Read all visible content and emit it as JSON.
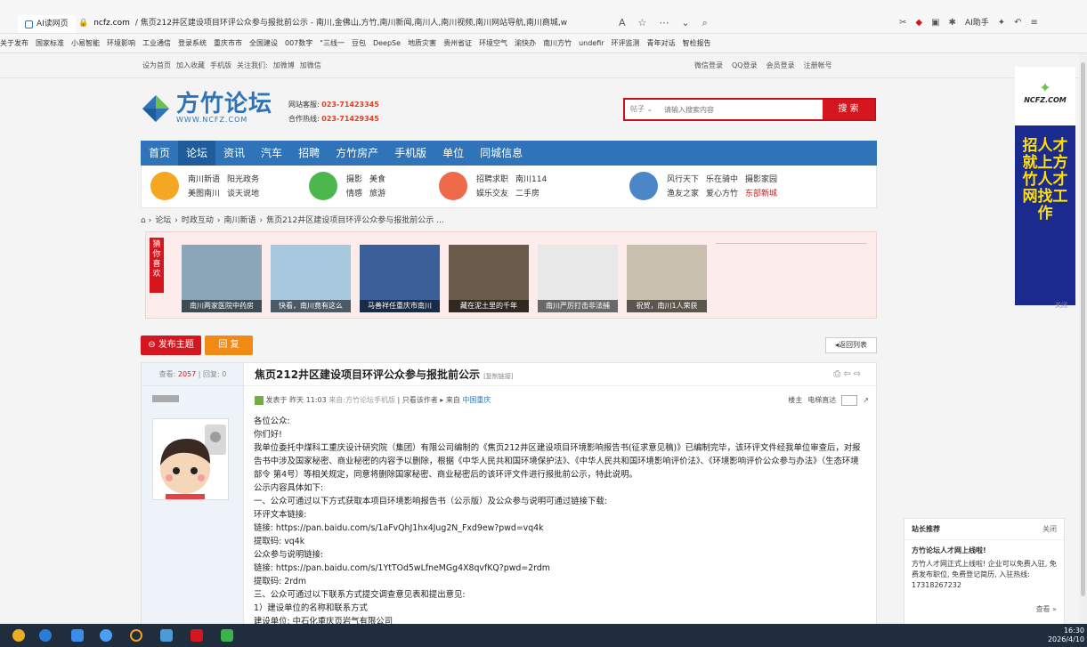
{
  "browser": {
    "tab_label": "AI读网页",
    "url_host": "ncfz.com",
    "url_rest": "/ 焦页212井区建设项目环评公众参与报批前公示 - 南川,金佛山,方竹,南川新闻,南川人,南川视频,南川网站导航,南川商城,w",
    "ai_label": "AI助手"
  },
  "bookmarks": [
    "关于发布",
    "国家标准",
    "小易智能",
    "环境影响",
    "工业通信",
    "登录系统",
    "重庆市市",
    "全国建设",
    "007数字",
    "\"三线一",
    "豆包",
    "DeepSe",
    "地质灾害",
    "贵州省证",
    "环境空气",
    "渝快办",
    "南川方竹",
    "undefir",
    "环评监测",
    "青年对话",
    "智检报告"
  ],
  "topbar": {
    "links": [
      "设为首页",
      "加入收藏",
      "手机版",
      "关注我们:",
      "加微博",
      "加微信"
    ],
    "right_links": [
      "微信登录",
      "QQ登录",
      "会员登录",
      "注册帐号"
    ]
  },
  "header": {
    "logo_text": "方竹论坛",
    "logo_sub": "WWW.NCFZ.COM",
    "hotline1_label": "网站客服:",
    "hotline1": "023-71423345",
    "hotline2_label": "合作热线:",
    "hotline2": "023-71429345"
  },
  "search": {
    "type": "帖子",
    "placeholder": "请输入搜索内容",
    "button": "搜 索"
  },
  "nav": [
    "首页",
    "论坛",
    "资讯",
    "汽车",
    "招聘",
    "方竹房产",
    "手机版",
    "单位",
    "同城信息"
  ],
  "subnav": [
    {
      "row1": [
        "南川新语",
        "阳光政务"
      ],
      "row2": [
        "美图南川",
        "谈天说地"
      ],
      "color": "#f5a623"
    },
    {
      "row1": [
        "摄影",
        "美食"
      ],
      "row2": [
        "情感",
        "旅游"
      ],
      "color": "#4cb74c"
    },
    {
      "row1": [
        "招聘求职",
        "南川114"
      ],
      "row2": [
        "娱乐交友",
        "二手房"
      ],
      "color": "#ee6a4a"
    },
    {
      "row1": [
        "风行天下",
        "乐在骑中",
        "摄影家园"
      ],
      "row2": [
        "渔友之家",
        "爱心方竹",
        "东部新城"
      ],
      "color": "#4a86c8"
    }
  ],
  "breadcrumb": [
    "论坛",
    "时政互动",
    "南川新语",
    "焦页212井区建设项目环评公众参与报批前公示 ..."
  ],
  "showcase": {
    "tag": "猜你喜欢",
    "items": [
      {
        "caption": "南川两家医院中药房",
        "color": "#8aa6b8"
      },
      {
        "caption": "快看，南川竟有这么",
        "color": "#a8c8e0"
      },
      {
        "caption": "马善祥任重庆市南川",
        "color": "#3a5f99"
      },
      {
        "caption": "藏在泥土里的千年",
        "color": "#6a5a4a"
      },
      {
        "caption": "南川严厉打击非法捕",
        "color": "#e8e8e8"
      },
      {
        "caption": "祝贺，南川1人荣获",
        "color": "#c8bfae"
      }
    ]
  },
  "actions": {
    "post": "发布主题",
    "reply": "回 复",
    "back": "返回列表"
  },
  "thread": {
    "views_label": "查看:",
    "views": "2057",
    "replies_label": "回复:",
    "replies": "0",
    "title": "焦页212井区建设项目环评公众参与报批前公示",
    "copy_link": "[复制链接]",
    "meta_prefix": "发表于",
    "meta_time": "昨天 11:03",
    "meta_source": "来自:方竹论坛手机版",
    "meta_only": "只看该作者",
    "meta_from": "来自",
    "meta_loc": "中国重庆",
    "floor": "楼主",
    "jump": "电梯直达",
    "content": [
      "各位公众:",
      "你们好!",
      "我单位委托中煤科工重庆设计研究院（集团）有限公司编制的《焦页212井区建设项目环境影响报告书(征求意见稿)》已编制完毕，该环评文件经我单位审查后，对报告书中涉及国家秘密、商业秘密的内容予以删除，根据《中华人民共和国环境保护法》、《中华人民共和国环境影响评价法》、《环境影响评价公众参与办法》（生态环境部令 第4号）等相关规定，同意将删除国家秘密、商业秘密后的该环评文件进行报批前公示，特此说明。",
      "公示内容具体如下:",
      "一、公众可通过以下方式获取本项目环境影响报告书（公示版）及公众参与说明可通过链接下载:",
      "环评文本链接:",
      "链接: https://pan.baidu.com/s/1aFvQhJ1hx4Jug2N_Fxd9ew?pwd=vq4k",
      "提取码: vq4k",
      "公众参与说明链接:",
      "链接: https://pan.baidu.com/s/1YtTOd5wLfneMGg4X8qvfKQ?pwd=2rdm",
      "提取码: 2rdm",
      "三、公众可通过以下联系方式提交调查意见表和提出意见:",
      "1）建设单位的名称和联系方式",
      "建设单位: 中石化重庆页岩气有限公司"
    ]
  },
  "ad": {
    "logo": "NCFZ.COM",
    "text": "招人才就上方竹人才网找工作",
    "close": "关闭"
  },
  "recommend": {
    "title": "站长推荐",
    "close": "关闭",
    "headline": "方竹论坛人才网上线啦!",
    "body": "方竹人才网正式上线啦! 企业可以免费入驻, 免费发布职位, 免费登记简历, 入驻热线: 17318267232",
    "more": "查看 »"
  },
  "clock": {
    "time": "16:30",
    "date": "2026/4/10"
  }
}
